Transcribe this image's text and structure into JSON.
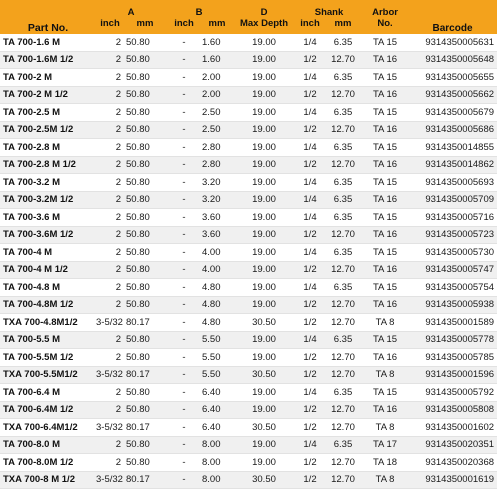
{
  "headers": {
    "part_no": "Part No.",
    "a": "A",
    "b": "B",
    "d": "D",
    "shank": "Shank",
    "arbor_line1": "Arbor",
    "arbor_line2": "No.",
    "barcode": "Barcode",
    "a_inch": "inch",
    "a_mm": "mm",
    "b_inch": "inch",
    "b_mm": "mm",
    "d_sub": "Max Depth",
    "shank_inch": "inch",
    "shank_mm": "mm"
  },
  "rows": [
    {
      "part": "TA 700-1.6 M",
      "a_inch": "2",
      "a_mm": "50.80",
      "b_inch": "-",
      "b_mm": "1.60",
      "d": "19.00",
      "s_inch": "1/4",
      "s_mm": "6.35",
      "arbor": "TA 15",
      "barcode": "9314350005631"
    },
    {
      "part": "TA 700-1.6M 1/2",
      "a_inch": "2",
      "a_mm": "50.80",
      "b_inch": "-",
      "b_mm": "1.60",
      "d": "19.00",
      "s_inch": "1/2",
      "s_mm": "12.70",
      "arbor": "TA 16",
      "barcode": "9314350005648"
    },
    {
      "part": "TA 700-2 M",
      "a_inch": "2",
      "a_mm": "50.80",
      "b_inch": "-",
      "b_mm": "2.00",
      "d": "19.00",
      "s_inch": "1/4",
      "s_mm": "6.35",
      "arbor": "TA 15",
      "barcode": "9314350005655"
    },
    {
      "part": "TA 700-2 M 1/2",
      "a_inch": "2",
      "a_mm": "50.80",
      "b_inch": "-",
      "b_mm": "2.00",
      "d": "19.00",
      "s_inch": "1/2",
      "s_mm": "12.70",
      "arbor": "TA 16",
      "barcode": "9314350005662"
    },
    {
      "part": "TA 700-2.5 M",
      "a_inch": "2",
      "a_mm": "50.80",
      "b_inch": "-",
      "b_mm": "2.50",
      "d": "19.00",
      "s_inch": "1/4",
      "s_mm": "6.35",
      "arbor": "TA 15",
      "barcode": "9314350005679"
    },
    {
      "part": "TA 700-2.5M 1/2",
      "a_inch": "2",
      "a_mm": "50.80",
      "b_inch": "-",
      "b_mm": "2.50",
      "d": "19.00",
      "s_inch": "1/2",
      "s_mm": "12.70",
      "arbor": "TA 16",
      "barcode": "9314350005686"
    },
    {
      "part": "TA 700-2.8 M",
      "a_inch": "2",
      "a_mm": "50.80",
      "b_inch": "-",
      "b_mm": "2.80",
      "d": "19.00",
      "s_inch": "1/4",
      "s_mm": "6.35",
      "arbor": "TA 15",
      "barcode": "9314350014855"
    },
    {
      "part": "TA 700-2.8 M 1/2",
      "a_inch": "2",
      "a_mm": "50.80",
      "b_inch": "-",
      "b_mm": "2.80",
      "d": "19.00",
      "s_inch": "1/2",
      "s_mm": "12.70",
      "arbor": "TA 16",
      "barcode": "9314350014862"
    },
    {
      "part": "TA 700-3.2 M",
      "a_inch": "2",
      "a_mm": "50.80",
      "b_inch": "-",
      "b_mm": "3.20",
      "d": "19.00",
      "s_inch": "1/4",
      "s_mm": "6.35",
      "arbor": "TA 15",
      "barcode": "9314350005693"
    },
    {
      "part": "TA 700-3.2M 1/2",
      "a_inch": "2",
      "a_mm": "50.80",
      "b_inch": "-",
      "b_mm": "3.20",
      "d": "19.00",
      "s_inch": "1/4",
      "s_mm": "6.35",
      "arbor": "TA 16",
      "barcode": "9314350005709"
    },
    {
      "part": "TA 700-3.6 M",
      "a_inch": "2",
      "a_mm": "50.80",
      "b_inch": "-",
      "b_mm": "3.60",
      "d": "19.00",
      "s_inch": "1/4",
      "s_mm": "6.35",
      "arbor": "TA 15",
      "barcode": "9314350005716"
    },
    {
      "part": "TA 700-3.6M 1/2",
      "a_inch": "2",
      "a_mm": "50.80",
      "b_inch": "-",
      "b_mm": "3.60",
      "d": "19.00",
      "s_inch": "1/2",
      "s_mm": "12.70",
      "arbor": "TA 16",
      "barcode": "9314350005723"
    },
    {
      "part": "TA 700-4 M",
      "a_inch": "2",
      "a_mm": "50.80",
      "b_inch": "-",
      "b_mm": "4.00",
      "d": "19.00",
      "s_inch": "1/4",
      "s_mm": "6.35",
      "arbor": "TA 15",
      "barcode": "9314350005730"
    },
    {
      "part": "TA 700-4 M 1/2",
      "a_inch": "2",
      "a_mm": "50.80",
      "b_inch": "-",
      "b_mm": "4.00",
      "d": "19.00",
      "s_inch": "1/2",
      "s_mm": "12.70",
      "arbor": "TA 16",
      "barcode": "9314350005747"
    },
    {
      "part": "TA 700-4.8 M",
      "a_inch": "2",
      "a_mm": "50.80",
      "b_inch": "-",
      "b_mm": "4.80",
      "d": "19.00",
      "s_inch": "1/4",
      "s_mm": "6.35",
      "arbor": "TA 15",
      "barcode": "9314350005754"
    },
    {
      "part": "TA 700-4.8M 1/2",
      "a_inch": "2",
      "a_mm": "50.80",
      "b_inch": "-",
      "b_mm": "4.80",
      "d": "19.00",
      "s_inch": "1/2",
      "s_mm": "12.70",
      "arbor": "TA 16",
      "barcode": "9314350005938"
    },
    {
      "part": "TXA 700-4.8M1/2",
      "a_inch": "3-5/32",
      "a_mm": "80.17",
      "b_inch": "-",
      "b_mm": "4.80",
      "d": "30.50",
      "s_inch": "1/2",
      "s_mm": "12.70",
      "arbor": "TA 8",
      "barcode": "9314350001589"
    },
    {
      "part": "TA 700-5.5 M",
      "a_inch": "2",
      "a_mm": "50.80",
      "b_inch": "-",
      "b_mm": "5.50",
      "d": "19.00",
      "s_inch": "1/4",
      "s_mm": "6.35",
      "arbor": "TA 15",
      "barcode": "9314350005778"
    },
    {
      "part": "TA 700-5.5M 1/2",
      "a_inch": "2",
      "a_mm": "50.80",
      "b_inch": "-",
      "b_mm": "5.50",
      "d": "19.00",
      "s_inch": "1/2",
      "s_mm": "12.70",
      "arbor": "TA 16",
      "barcode": "9314350005785"
    },
    {
      "part": "TXA 700-5.5M1/2",
      "a_inch": "3-5/32",
      "a_mm": "80.17",
      "b_inch": "-",
      "b_mm": "5.50",
      "d": "30.50",
      "s_inch": "1/2",
      "s_mm": "12.70",
      "arbor": "TA 8",
      "barcode": "9314350001596"
    },
    {
      "part": "TA 700-6.4 M",
      "a_inch": "2",
      "a_mm": "50.80",
      "b_inch": "-",
      "b_mm": "6.40",
      "d": "19.00",
      "s_inch": "1/4",
      "s_mm": "6.35",
      "arbor": "TA 15",
      "barcode": "9314350005792"
    },
    {
      "part": "TA 700-6.4M 1/2",
      "a_inch": "2",
      "a_mm": "50.80",
      "b_inch": "-",
      "b_mm": "6.40",
      "d": "19.00",
      "s_inch": "1/2",
      "s_mm": "12.70",
      "arbor": "TA 16",
      "barcode": "9314350005808"
    },
    {
      "part": "TXA 700-6.4M1/2",
      "a_inch": "3-5/32",
      "a_mm": "80.17",
      "b_inch": "-",
      "b_mm": "6.40",
      "d": "30.50",
      "s_inch": "1/2",
      "s_mm": "12.70",
      "arbor": "TA 8",
      "barcode": "9314350001602"
    },
    {
      "part": "TA 700-8.0 M",
      "a_inch": "2",
      "a_mm": "50.80",
      "b_inch": "-",
      "b_mm": "8.00",
      "d": "19.00",
      "s_inch": "1/4",
      "s_mm": "6.35",
      "arbor": "TA 17",
      "barcode": "9314350020351"
    },
    {
      "part": "TA 700-8.0M 1/2",
      "a_inch": "2",
      "a_mm": "50.80",
      "b_inch": "-",
      "b_mm": "8.00",
      "d": "19.00",
      "s_inch": "1/2",
      "s_mm": "12.70",
      "arbor": "TA 18",
      "barcode": "9314350020368"
    },
    {
      "part": "TXA 700-8 M 1/2",
      "a_inch": "3-5/32",
      "a_mm": "80.17",
      "b_inch": "-",
      "b_mm": "8.00",
      "d": "30.50",
      "s_inch": "1/2",
      "s_mm": "12.70",
      "arbor": "TA 8",
      "barcode": "9314350001619"
    }
  ]
}
